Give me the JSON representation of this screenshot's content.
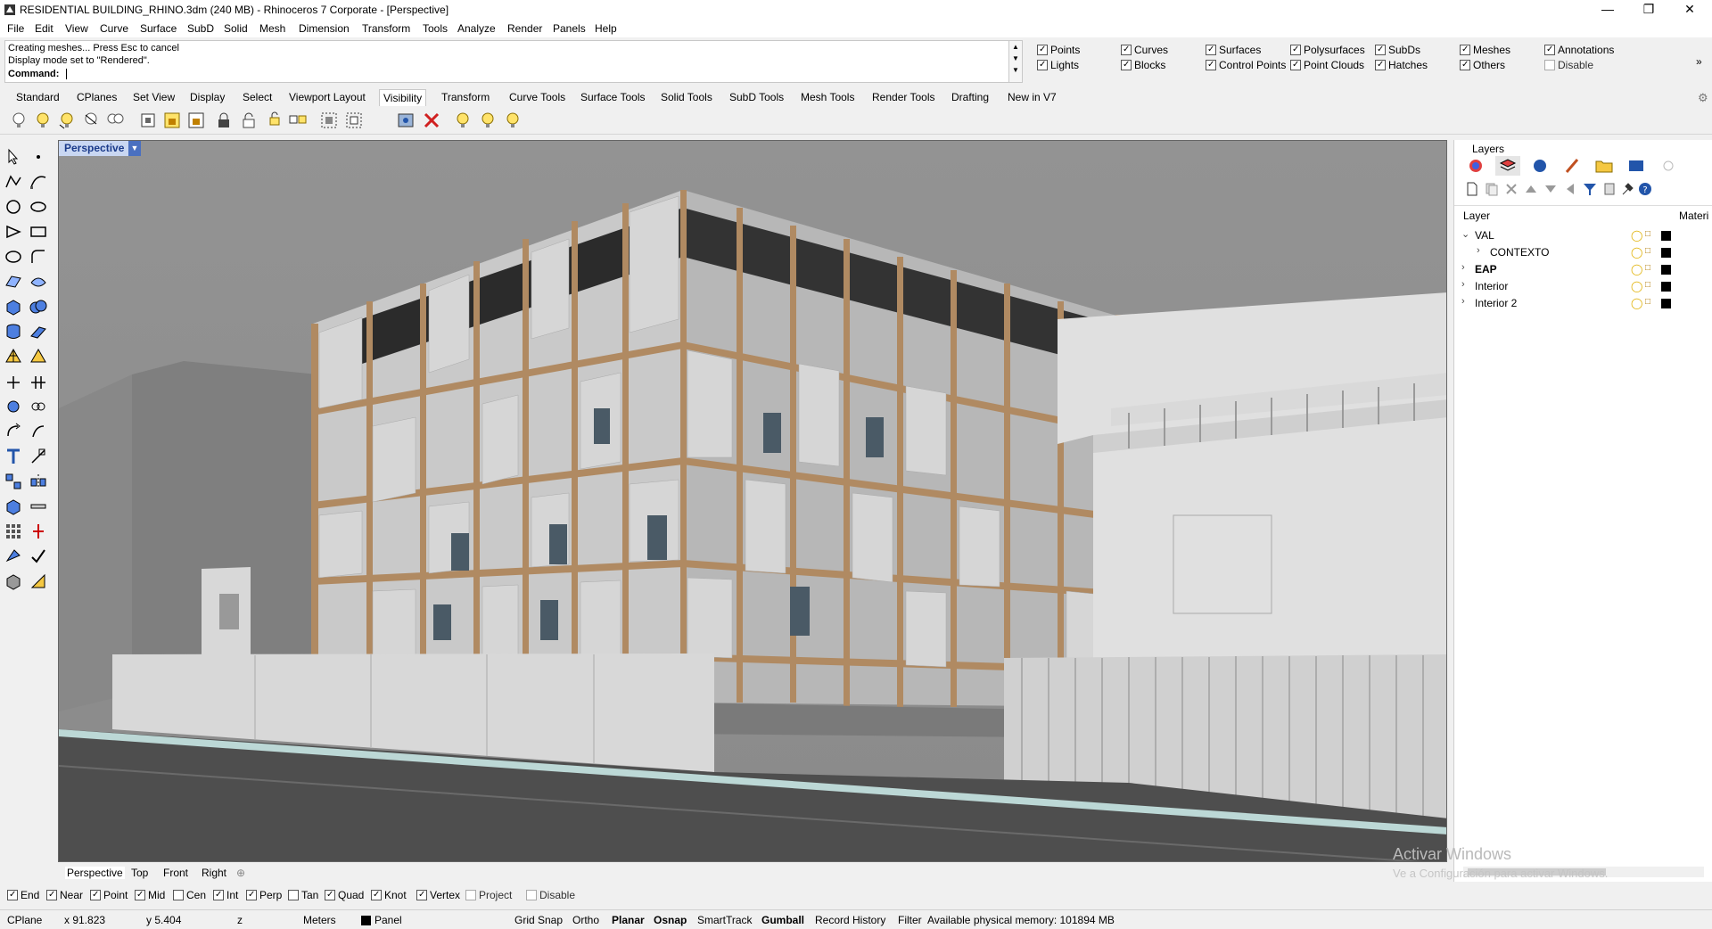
{
  "window": {
    "title": "RESIDENTIAL BUILDING_RHINO.3dm (240 MB) - Rhinoceros 7 Corporate - [Perspective]",
    "minimize": "—",
    "maximize": "❐",
    "close": "✕"
  },
  "menu": [
    "File",
    "Edit",
    "View",
    "Curve",
    "Surface",
    "SubD",
    "Solid",
    "Mesh",
    "Dimension",
    "Transform",
    "Tools",
    "Analyze",
    "Render",
    "Panels",
    "Help"
  ],
  "command": {
    "history": [
      "Creating meshes... Press Esc to cancel",
      "Display mode set to \"Rendered\"."
    ],
    "prompt": "Command:"
  },
  "visibility_filter": [
    {
      "label": "Points",
      "checked": true
    },
    {
      "label": "Curves",
      "checked": true
    },
    {
      "label": "Surfaces",
      "checked": true
    },
    {
      "label": "Polysurfaces",
      "checked": true
    },
    {
      "label": "SubDs",
      "checked": true
    },
    {
      "label": "Meshes",
      "checked": true
    },
    {
      "label": "Annotations",
      "checked": true
    },
    {
      "label": "Lights",
      "checked": true
    },
    {
      "label": "Blocks",
      "checked": true
    },
    {
      "label": "Control Points",
      "checked": true
    },
    {
      "label": "Point Clouds",
      "checked": true
    },
    {
      "label": "Hatches",
      "checked": true
    },
    {
      "label": "Others",
      "checked": true
    },
    {
      "label": "Disable",
      "checked": false
    }
  ],
  "toolbar_tabs": [
    "Standard",
    "CPlanes",
    "Set View",
    "Display",
    "Select",
    "Viewport Layout",
    "Visibility",
    "Transform",
    "Curve Tools",
    "Surface Tools",
    "Solid Tools",
    "SubD Tools",
    "Mesh Tools",
    "Render Tools",
    "Drafting",
    "New in V7"
  ],
  "active_toolbar_tab": "Visibility",
  "viewport": {
    "name": "Perspective",
    "tabs": [
      "Perspective",
      "Top",
      "Front",
      "Right"
    ],
    "add_tab": "⊕"
  },
  "osnaps": [
    {
      "label": "End",
      "checked": true
    },
    {
      "label": "Near",
      "checked": true
    },
    {
      "label": "Point",
      "checked": true
    },
    {
      "label": "Mid",
      "checked": true
    },
    {
      "label": "Cen",
      "checked": false
    },
    {
      "label": "Int",
      "checked": true
    },
    {
      "label": "Perp",
      "checked": true
    },
    {
      "label": "Tan",
      "checked": false
    },
    {
      "label": "Quad",
      "checked": true
    },
    {
      "label": "Knot",
      "checked": true
    },
    {
      "label": "Vertex",
      "checked": true
    },
    {
      "label": "Project",
      "checked": false
    },
    {
      "label": "Disable",
      "checked": false
    }
  ],
  "status": {
    "cplane": "CPlane",
    "x": "x 91.823",
    "y": "y 5.404",
    "z": "z",
    "units": "Meters",
    "layer": "Panel",
    "grid_snap": "Grid Snap",
    "ortho": "Ortho",
    "planar": "Planar",
    "osnap": "Osnap",
    "smarttrack": "SmartTrack",
    "gumball": "Gumball",
    "record_history": "Record History",
    "filter": "Filter",
    "memory": "Available physical memory: 101894 MB"
  },
  "layers_panel": {
    "title": "Layers",
    "column_layer": "Layer",
    "column_material": "Materi",
    "rows": [
      {
        "name": "VAL",
        "expanded": true,
        "indent": 0,
        "bold": false
      },
      {
        "name": "CONTEXTO",
        "expanded": false,
        "indent": 1,
        "bold": false
      },
      {
        "name": "EAP",
        "expanded": false,
        "indent": 0,
        "bold": true
      },
      {
        "name": "Interior",
        "expanded": false,
        "indent": 0,
        "bold": false
      },
      {
        "name": "Interior 2",
        "expanded": false,
        "indent": 0,
        "bold": false
      }
    ]
  },
  "watermark": {
    "line1": "Activar Windows",
    "line2": "Ve a Configuración para activar Windows."
  },
  "colors": {
    "wood": "#b08a62",
    "panel": "#d4d4d4",
    "sky": "#8e8e8e",
    "selected_tab": "#c9d7f2"
  }
}
